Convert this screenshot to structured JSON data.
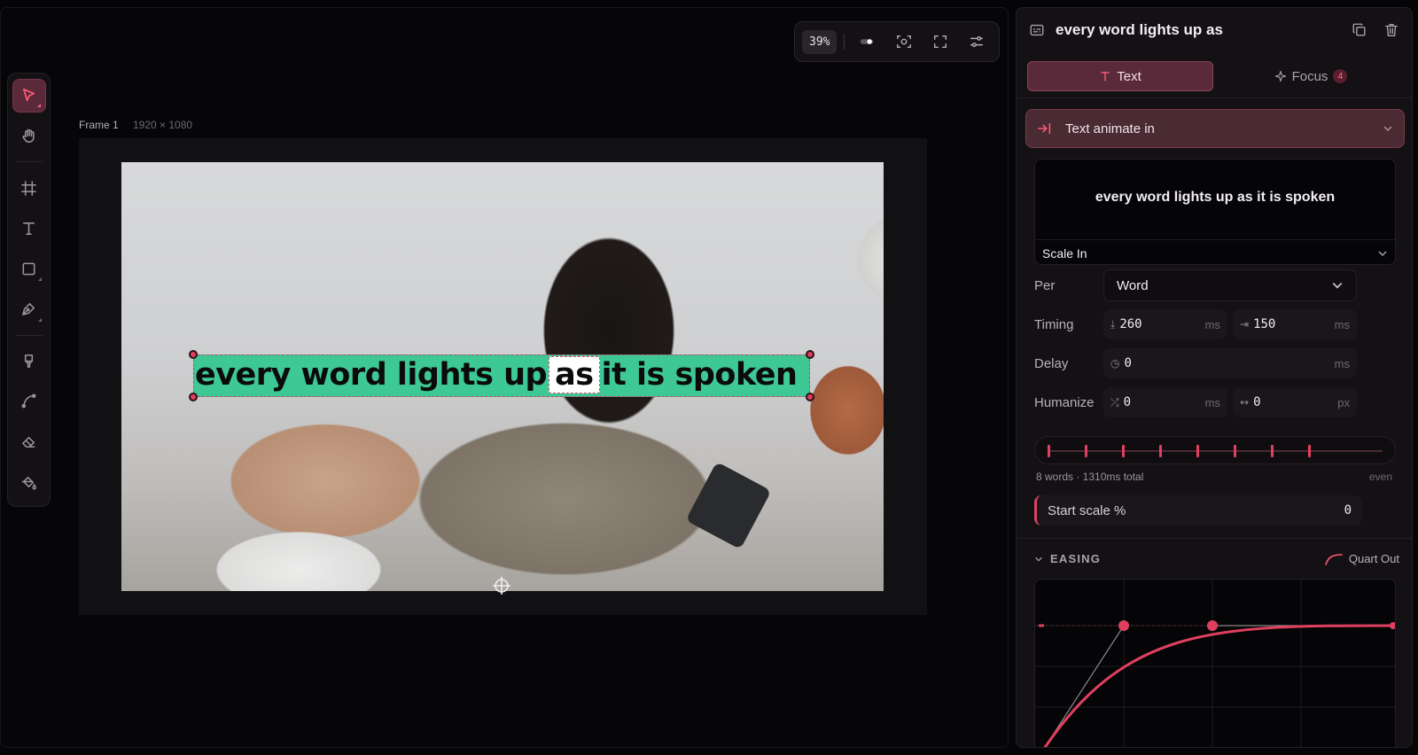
{
  "canvas": {
    "zoom": "39%",
    "frame_label": "Frame 1",
    "frame_dimensions": "1920 × 1080",
    "caption": {
      "before": "every word lights up",
      "highlight": "as",
      "after": "it is spoken",
      "box_color": "#3ec896",
      "highlight_color": "#ffffff"
    }
  },
  "toolbar": {
    "tools": [
      "select",
      "hand",
      "frame",
      "text",
      "rectangle",
      "pen",
      "brush",
      "path",
      "eraser",
      "fill"
    ]
  },
  "panel": {
    "title": "every word lights up as",
    "tabs": {
      "text": "Text",
      "focus": "Focus",
      "focus_count": "4"
    },
    "animation": {
      "title": "Text animate in",
      "preview_text": "every word lights up as it is spoken",
      "preset": "Scale In"
    },
    "per": {
      "label": "Per",
      "value": "Word"
    },
    "timing": {
      "label": "Timing",
      "duration": "260",
      "stagger": "150",
      "unit": "ms"
    },
    "delay": {
      "label": "Delay",
      "value": "0",
      "unit": "ms"
    },
    "humanize": {
      "label": "Humanize",
      "time": "0",
      "time_unit": "ms",
      "offset": "0",
      "offset_unit": "px"
    },
    "track": {
      "summary": "8 words · 1310ms total",
      "distribution": "even",
      "word_count": 8
    },
    "start_scale": {
      "label": "Start scale %",
      "value": "0"
    },
    "easing": {
      "label": "EASING",
      "type": "Quart Out"
    },
    "accent": "#e0405f"
  }
}
